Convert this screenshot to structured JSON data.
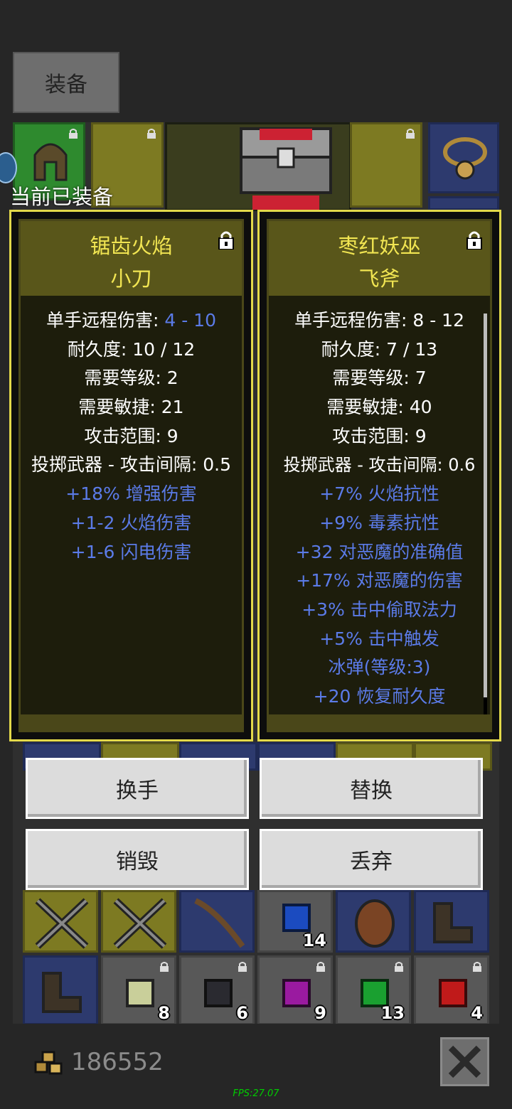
{
  "top_tab": {
    "label": "装备"
  },
  "equipped_label": "当前已装备",
  "left_item": {
    "name_line1": "锯齿火焰",
    "name_line2": "小刀",
    "damage_label": "单手远程伤害: ",
    "damage_value": "4 - 10",
    "stats": [
      "耐久度: 10 / 12",
      "需要等级: 2",
      "需要敏捷: 21",
      "攻击范围: 9",
      "投掷武器 - 攻击间隔: 0.5"
    ],
    "mods": [
      "+18% 增强伤害",
      "+1-2 火焰伤害",
      "+1-6 闪电伤害"
    ]
  },
  "right_item": {
    "name_line1": "枣红妖巫",
    "name_line2": "飞斧",
    "stats": [
      "单手远程伤害: 8 - 12",
      "耐久度: 7 / 13",
      "需要等级: 7",
      "需要敏捷: 40",
      "攻击范围: 9",
      "投掷武器 - 攻击间隔: 0.6"
    ],
    "mods": [
      "+7% 火焰抗性",
      "+9% 毒素抗性",
      "+32 对恶魔的准确值",
      "+17% 对恶魔的伤害",
      "+3% 击中偷取法力",
      "+5% 击中触发",
      "冰弹(等级:3)",
      "+20 恢复耐久度"
    ]
  },
  "buttons": {
    "swap_hand": "换手",
    "replace": "替换",
    "destroy": "销毁",
    "discard": "丢弃"
  },
  "inventory_counts": [
    "14",
    "8",
    "6",
    "9",
    "13",
    "4"
  ],
  "gold": "186552",
  "fps": "FPS:27.07",
  "colors": {
    "panel_border": "#e3d94a",
    "item_name": "#f1e552",
    "mod_text": "#5b7be8"
  },
  "icons": [
    "lock-icon",
    "gold-icon",
    "close-icon",
    "chest-icon",
    "amulet-icon"
  ]
}
